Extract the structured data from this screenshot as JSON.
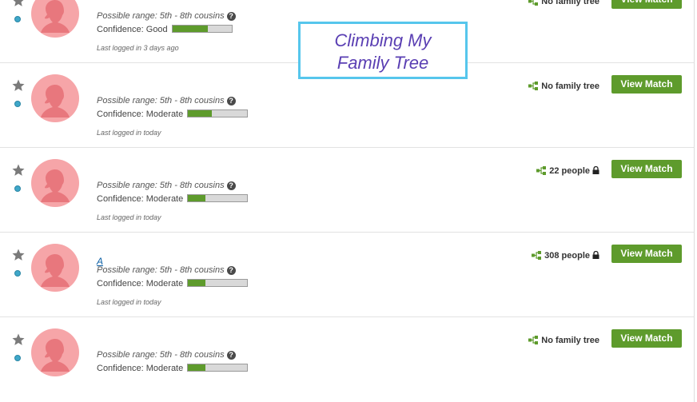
{
  "matches": [
    {
      "name": "",
      "possible_range": "Possible range: 5th - 8th cousins",
      "confidence_label": "Confidence: Good",
      "confidence_level": 0.6,
      "last_logged": "Last logged in 3 days ago",
      "tree_text": "No family tree",
      "tree_locked": false,
      "button_label": "View Match"
    },
    {
      "name": "",
      "possible_range": "Possible range: 5th - 8th cousins",
      "confidence_label": "Confidence: Moderate",
      "confidence_level": 0.4,
      "last_logged": "Last logged in today",
      "tree_text": "No family tree",
      "tree_locked": false,
      "button_label": "View Match"
    },
    {
      "name": "",
      "possible_range": "Possible range: 5th - 8th cousins",
      "confidence_label": "Confidence: Moderate",
      "confidence_level": 0.3,
      "last_logged": "Last logged in today",
      "tree_text": "22 people",
      "tree_locked": true,
      "button_label": "View Match"
    },
    {
      "name": "A",
      "possible_range": "Possible range: 5th - 8th cousins",
      "confidence_label": "Confidence: Moderate",
      "confidence_level": 0.3,
      "last_logged": "Last logged in today",
      "tree_text": "308 people",
      "tree_locked": true,
      "button_label": "View Match"
    },
    {
      "name": "",
      "possible_range": "Possible range: 5th - 8th cousins",
      "confidence_label": "Confidence: Moderate",
      "confidence_level": 0.3,
      "last_logged": "",
      "tree_text": "No family tree",
      "tree_locked": false,
      "button_label": "View Match"
    }
  ],
  "overlay": {
    "text": "Climbing My\nFamily Tree"
  },
  "colors": {
    "accent_green": "#5e9b2c",
    "avatar_pink": "#f6a5a8",
    "online_dot": "#3fa7c9",
    "overlay_border": "#56c6ec",
    "overlay_text": "#5a3fb3"
  },
  "icons": [
    "star-icon",
    "online-status-icon",
    "avatar-silhouette-icon",
    "help-icon",
    "family-tree-icon",
    "lock-icon"
  ]
}
